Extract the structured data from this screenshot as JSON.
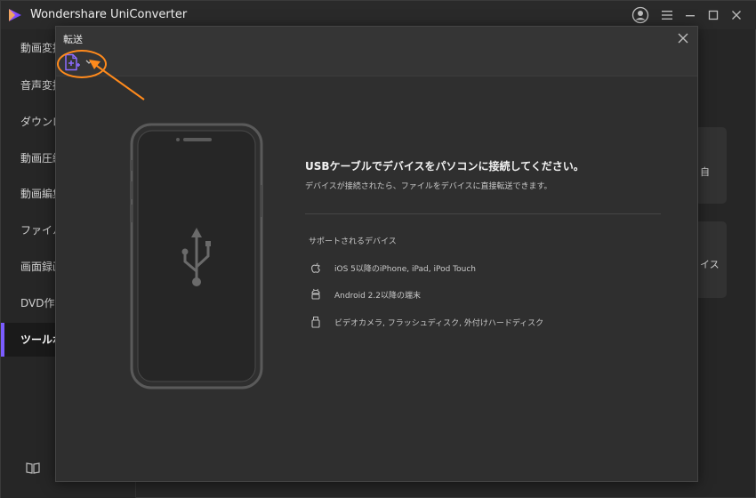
{
  "app": {
    "title": "Wondershare UniConverter"
  },
  "sidebar": {
    "items": [
      {
        "label": "動画変換"
      },
      {
        "label": "音声変換"
      },
      {
        "label": "ダウンロード"
      },
      {
        "label": "動画圧縮"
      },
      {
        "label": "動画編集"
      },
      {
        "label": "ファイル結合"
      },
      {
        "label": "画面録画"
      },
      {
        "label": "DVD作成"
      },
      {
        "label": "ツールボックス"
      }
    ],
    "active_index": 8
  },
  "background_cards": [
    {
      "text": "自"
    },
    {
      "text": "イス"
    }
  ],
  "dialog": {
    "title": "転送",
    "heading": "USBケーブルでデバイスをパソコンに接続してください。",
    "subtext": "デバイスが接続されたら、ファイルをデバイスに直接転送できます。",
    "supported_label": "サポートされるデバイス",
    "devices": [
      {
        "icon": "apple-icon",
        "text": "iOS 5以降のiPhone, iPad, iPod Touch"
      },
      {
        "icon": "android-icon",
        "text": "Android 2.2以降の端末"
      },
      {
        "icon": "usb-drive-icon",
        "text": "ビデオカメラ, フラッシュディスク, 外付けハードディスク"
      }
    ]
  },
  "colors": {
    "accent": "#7b5cff",
    "annotation": "#ff8a1c"
  }
}
